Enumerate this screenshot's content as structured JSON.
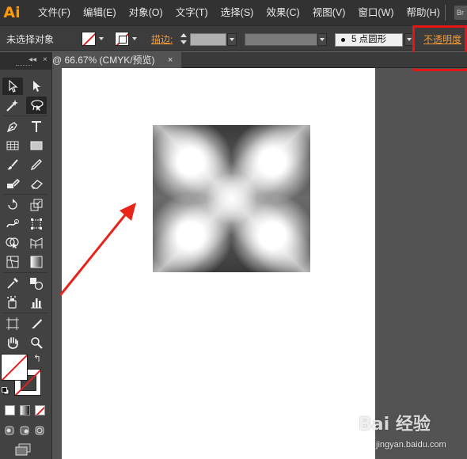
{
  "app": {
    "logo": "Ai",
    "menu": [
      "文件(F)",
      "编辑(E)",
      "对象(O)",
      "文字(T)",
      "选择(S)",
      "效果(C)",
      "视图(V)",
      "窗口(W)",
      "帮助(H)"
    ],
    "bridge_button": "Br"
  },
  "control_bar": {
    "selection_status": "未选择对象",
    "stroke_label": "描边:",
    "brush_label": "5 点圆形",
    "opacity_label": "不透明度"
  },
  "document": {
    "tab_title": "@ 66.67% (CMYK/预览)",
    "close_symbol": "×"
  },
  "tools_panel": {
    "collapse_symbol": "◂◂",
    "close_symbol": "×",
    "swap_symbol": "↰"
  },
  "watermark": {
    "text": "Bai 经验",
    "url": "jingyan.baidu.com"
  },
  "colors": {
    "accent_orange": "#f19a37",
    "logo_orange": "#ff9a00",
    "highlight_red": "#e51515",
    "arrow_red": "#e8231a",
    "none_swatch_red": "#e02020"
  }
}
